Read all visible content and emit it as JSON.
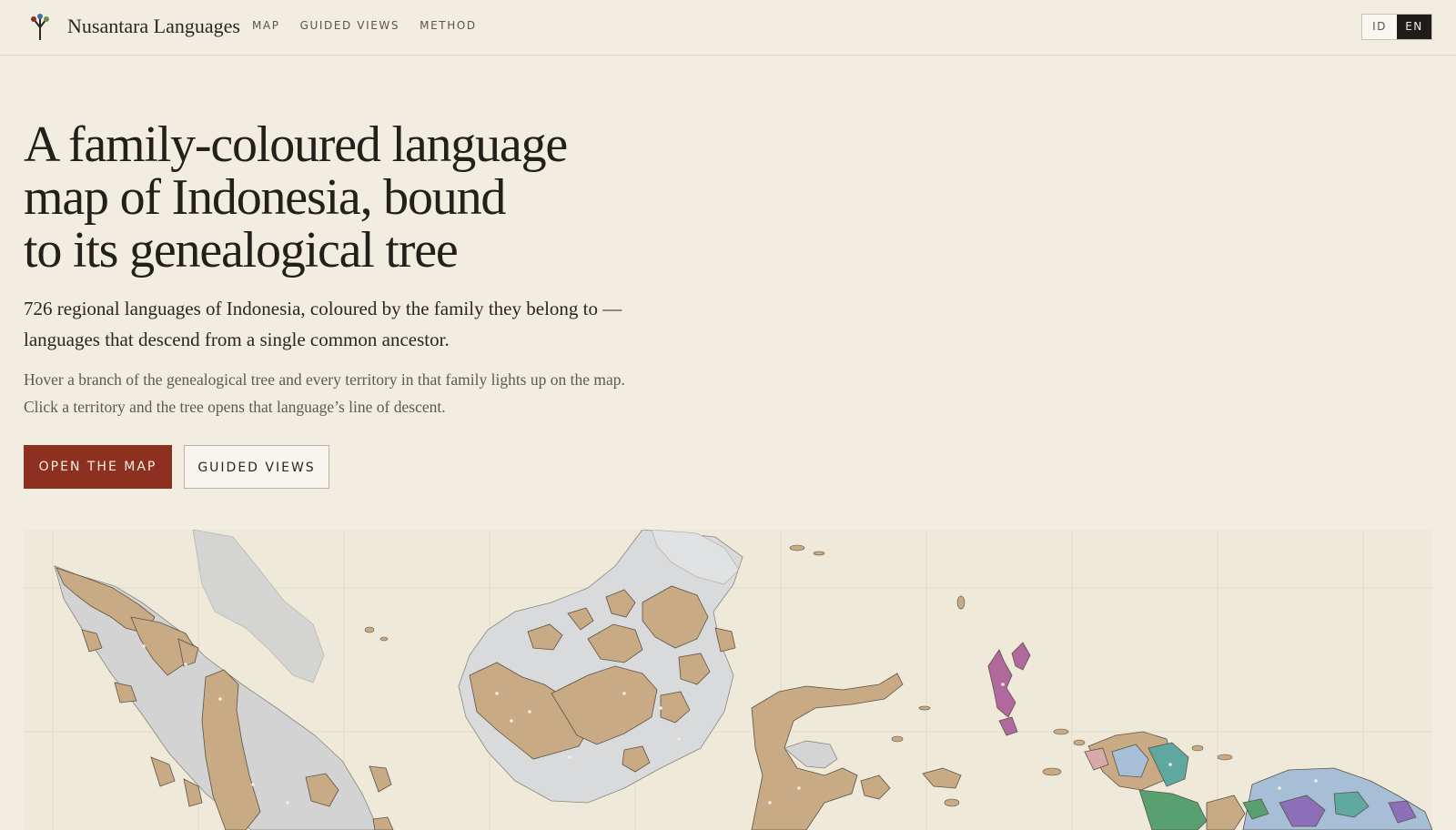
{
  "header": {
    "site_title": "Nusantara Languages",
    "nav": [
      "MAP",
      "GUIDED VIEWS",
      "METHOD"
    ],
    "lang_options": [
      "ID",
      "EN"
    ],
    "active_lang": "EN"
  },
  "hero": {
    "headline_lines": [
      "A family-coloured language",
      "map of Indonesia, bound",
      "to its genealogical tree"
    ],
    "lead_lines": [
      "726 regional languages of Indonesia, coloured by the family they belong to —",
      "languages that descend from a single common ancestor."
    ],
    "sub_lines": [
      "Hover a branch of the genealogical tree and every territory in that family lights up on the map.",
      "Click a territory and the tree opens that language’s line of descent."
    ],
    "primary_button": "OPEN THE MAP",
    "secondary_button": "GUIDED VIEWS"
  },
  "map": {
    "colors": {
      "land_unmapped": "#d3d4d3",
      "family_main": "#c8ab84",
      "family_magenta": "#b0689d",
      "family_blue": "#a7bfd6",
      "family_green": "#58a06f",
      "family_purple": "#8c6fb8",
      "family_pink": "#d8a9aa",
      "family_teal": "#5ea8a0",
      "border": "#5d5246"
    }
  },
  "colors": {
    "background": "#f2ede1",
    "accent": "#8e3020",
    "ink": "#231f1b"
  }
}
